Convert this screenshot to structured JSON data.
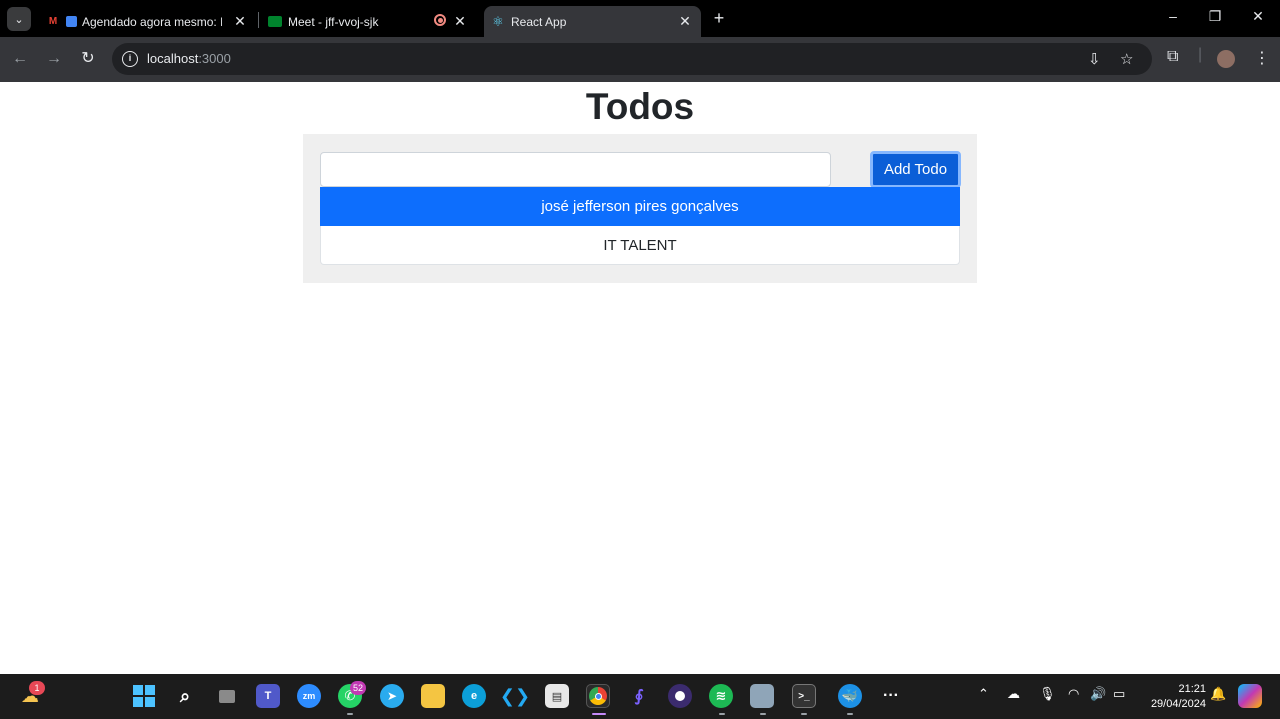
{
  "browser": {
    "tabs": [
      {
        "title": "Agendado agora mesmo: M",
        "favicon": "gmail-calendar-icon",
        "active": false
      },
      {
        "title": "Meet - jff-vvoj-sjk",
        "favicon": "meet-icon",
        "active": false
      },
      {
        "title": "React App",
        "favicon": "react-icon",
        "active": true
      }
    ],
    "url_host": "localhost",
    "url_port": ":3000"
  },
  "page": {
    "title": "Todos",
    "input": {
      "value": "",
      "placeholder": ""
    },
    "add_button_label": "Add Todo",
    "todos": [
      {
        "text": "josé jefferson pires gonçalves",
        "active": true
      },
      {
        "text": "IT TALENT",
        "active": false
      }
    ]
  },
  "taskbar": {
    "weather_badge": "1",
    "whatsapp_badge": "52",
    "time": "21:21",
    "date": "29/04/2024"
  },
  "colors": {
    "primary": "#0d6efd",
    "button": "#0b5ed7",
    "card_bg": "#efefef",
    "chrome_bg": "#202124"
  }
}
